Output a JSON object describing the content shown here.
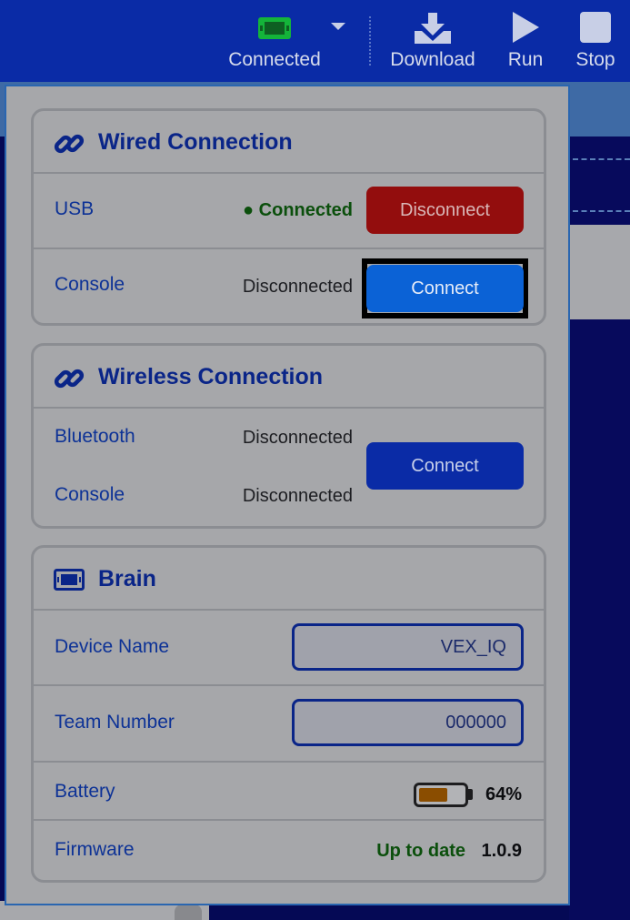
{
  "toolbar": {
    "connected_label": "Connected",
    "download_label": "Download",
    "run_label": "Run",
    "stop_label": "Stop"
  },
  "wired": {
    "title": "Wired Connection",
    "usb_label": "USB",
    "usb_status": "Connected",
    "usb_button": "Disconnect",
    "console_label": "Console",
    "console_status": "Disconnected",
    "console_button": "Connect"
  },
  "wireless": {
    "title": "Wireless Connection",
    "bluetooth_label": "Bluetooth",
    "bluetooth_status": "Disconnected",
    "console_label": "Console",
    "console_status": "Disconnected",
    "button": "Connect"
  },
  "brain": {
    "title": "Brain",
    "device_name_label": "Device Name",
    "device_name_value": "VEX_IQ",
    "team_number_label": "Team Number",
    "team_number_value": "000000",
    "battery_label": "Battery",
    "battery_percent": "64%",
    "battery_level": 0.64,
    "firmware_label": "Firmware",
    "firmware_status": "Up to date",
    "firmware_version": "1.0.9"
  },
  "colors": {
    "toolbar": "#0a2ba6",
    "accent": "#0a2588",
    "connected_green": "#0b4f0c",
    "disconnect_red": "#930d0d",
    "connect_blue": "#0b62d6",
    "battery": "#8a4d00"
  },
  "icons": {
    "connected": "brain-icon",
    "connected_menu": "caret-down-icon",
    "download": "download-icon",
    "run": "play-icon",
    "stop": "stop-icon",
    "wired": "link-icon",
    "wireless": "link-icon",
    "brain": "brain-icon"
  }
}
